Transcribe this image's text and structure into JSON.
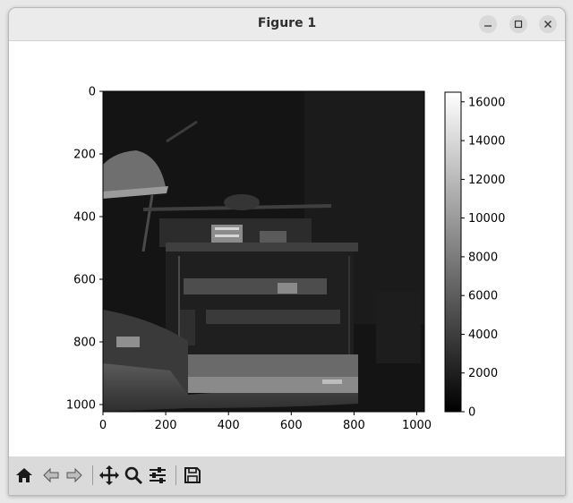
{
  "window": {
    "title": "Figure 1"
  },
  "titlebar_buttons": {
    "minimize": "–",
    "maximize": "□",
    "close": "✕"
  },
  "chart_data": {
    "type": "heatmap",
    "colormap": "gray",
    "x_ticks": [
      "0",
      "200",
      "400",
      "600",
      "800",
      "1000"
    ],
    "y_ticks": [
      "0",
      "200",
      "400",
      "600",
      "800",
      "1000"
    ],
    "xlim": [
      0,
      1024
    ],
    "ylim": [
      1024,
      0
    ],
    "colorbar": {
      "ticks": [
        "0",
        "2000",
        "4000",
        "6000",
        "8000",
        "10000",
        "12000",
        "14000",
        "16000"
      ],
      "range": [
        0,
        16500
      ]
    }
  },
  "toolbar": {
    "icons": [
      "home-icon",
      "back-icon",
      "forward-icon",
      "pan-icon",
      "zoom-icon",
      "configure-icon",
      "save-icon"
    ]
  }
}
